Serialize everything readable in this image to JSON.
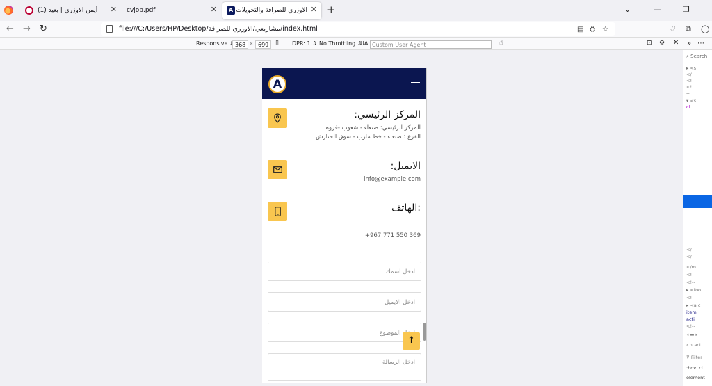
{
  "browser": {
    "tabs": [
      {
        "label": "أيمن الاوزري | بعيد (1)"
      },
      {
        "label": "cvjob.pdf"
      },
      {
        "label": "الاوزري للصرافة والتحويلات"
      }
    ],
    "url": "file:///C:/Users/HP/Desktop/مشاريعي/الاوزري للصرافة/index.html"
  },
  "responsive_toolbar": {
    "mode": "Responsive",
    "width": "368",
    "height": "699",
    "dpr": "DPR: 1",
    "throttling": "No Throttling",
    "ua_label": "UA:",
    "ua_placeholder": "Custom User Agent"
  },
  "site": {
    "logo_letter": "A",
    "contact": {
      "address_title": "المركز الرئيسي:",
      "address_line1": "المركز الرئيسي: صنعاء - شعوب -فروه",
      "address_line2": "الفرع : صنعاء - خط مارب - سوق الحتارش",
      "email_title": "الايميل:",
      "email_value": "info@example.com",
      "phone_title": ":الهاتف",
      "phone_value": "+967 771 550 369"
    },
    "form": {
      "name_placeholder": "ادخل اسمك",
      "email_placeholder": "ادخل الايميل",
      "subject_placeholder": "ادخل الموضوع",
      "message_placeholder": "ادخل الرسالة"
    }
  },
  "devtools": {
    "search_placeholder": "Search",
    "contact_fragment": "ntact",
    "filter_label": "Filter",
    "hov_label": ":hov .cl",
    "element_label": "element"
  },
  "colors": {
    "header_bg": "#0b1650",
    "accent": "#f9c64f",
    "selection": "#0a66e4"
  }
}
